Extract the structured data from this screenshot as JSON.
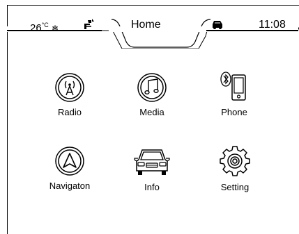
{
  "status_bar": {
    "temperature": "26°C",
    "temp_number": "26",
    "temp_unit": "°C",
    "title": "Home",
    "time": "11:08",
    "icons": [
      "snowflake-icon",
      "seat-heat-icon",
      "car-icon"
    ]
  },
  "apps": [
    {
      "label": "Radio",
      "icon": "radio-antenna-icon"
    },
    {
      "label": "Media",
      "icon": "music-note-icon"
    },
    {
      "label": "Phone",
      "icon": "bluetooth-phone-icon"
    },
    {
      "label": "Navigaton",
      "icon": "navigation-arrow-icon"
    },
    {
      "label": "Info",
      "icon": "car-front-icon"
    },
    {
      "label": "Setting",
      "icon": "gear-icon"
    }
  ]
}
